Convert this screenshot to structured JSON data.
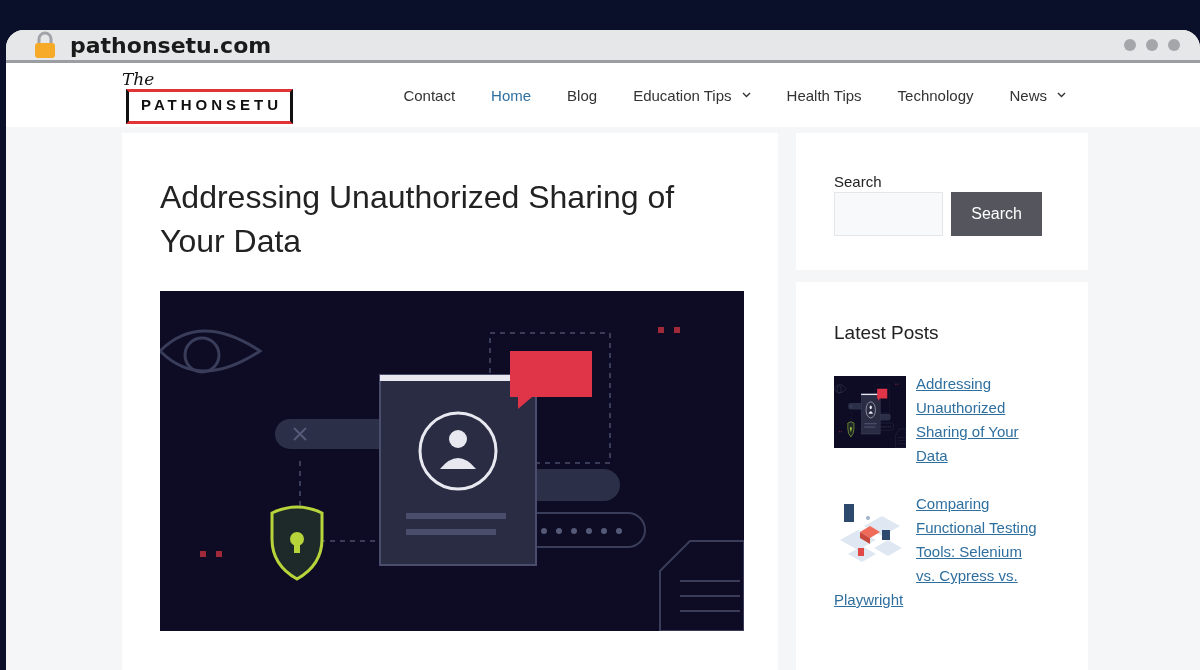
{
  "browser": {
    "url": "pathonsetu.com"
  },
  "logo": {
    "script": "The",
    "name": "PATHONSETU"
  },
  "nav": [
    {
      "label": "Contact",
      "selected": false,
      "has_submenu": false
    },
    {
      "label": "Home",
      "selected": true,
      "has_submenu": false
    },
    {
      "label": "Blog",
      "selected": false,
      "has_submenu": false
    },
    {
      "label": "Education Tips",
      "selected": false,
      "has_submenu": true
    },
    {
      "label": "Health Tips",
      "selected": false,
      "has_submenu": false
    },
    {
      "label": "Technology",
      "selected": false,
      "has_submenu": false
    },
    {
      "label": "News",
      "selected": false,
      "has_submenu": true
    }
  ],
  "article": {
    "title": "Addressing Unauthorized Sharing of Your Data"
  },
  "search_widget": {
    "label": "Search",
    "button": "Search"
  },
  "latest_posts": {
    "heading": "Latest Posts",
    "items": [
      {
        "title": "Addressing Unauthorized Sharing of Your Data",
        "kind": "security"
      },
      {
        "title": "Comparing Functional Testing Tools: Selenium vs. Cypress vs. Playwright",
        "kind": "isometric"
      }
    ]
  }
}
